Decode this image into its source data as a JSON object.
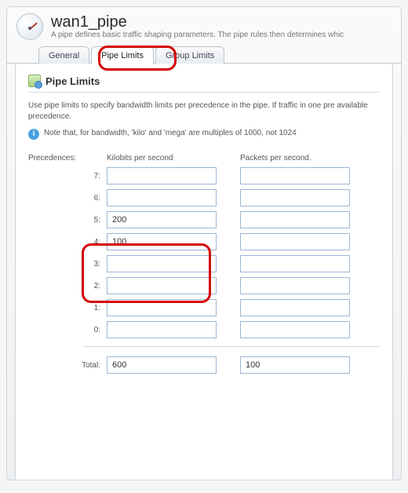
{
  "header": {
    "title": "wan1_pipe",
    "subtitle": "A pipe defines basic traffic shaping parameters. The pipe rules then determines whic"
  },
  "tabs": {
    "general": "General",
    "pipe_limits": "Pipe Limits",
    "group_limits": "Group Limits"
  },
  "section": {
    "title": "Pipe Limits",
    "help": "Use pipe limits to specify bandwidth limits per precedence in the pipe. If traffic in one pre available precedence.",
    "note": "Note that, for bandwidth, 'kilo' and 'mega' are multiples of 1000, not 1024"
  },
  "columns": {
    "label": "Precedences:",
    "kbps": "Kilobits per second",
    "pps": "Packets per second."
  },
  "rows": {
    "p7": {
      "label": "7:",
      "kbps": "",
      "pps": ""
    },
    "p6": {
      "label": "6:",
      "kbps": "",
      "pps": ""
    },
    "p5": {
      "label": "5:",
      "kbps": "200",
      "pps": ""
    },
    "p4": {
      "label": "4:",
      "kbps": "100",
      "pps": ""
    },
    "p3": {
      "label": "3:",
      "kbps": "",
      "pps": ""
    },
    "p2": {
      "label": "2:",
      "kbps": "",
      "pps": ""
    },
    "p1": {
      "label": "1:",
      "kbps": "",
      "pps": ""
    },
    "p0": {
      "label": "0:",
      "kbps": "",
      "pps": ""
    }
  },
  "totals": {
    "label": "Total:",
    "kbps": "600",
    "pps": "100"
  }
}
